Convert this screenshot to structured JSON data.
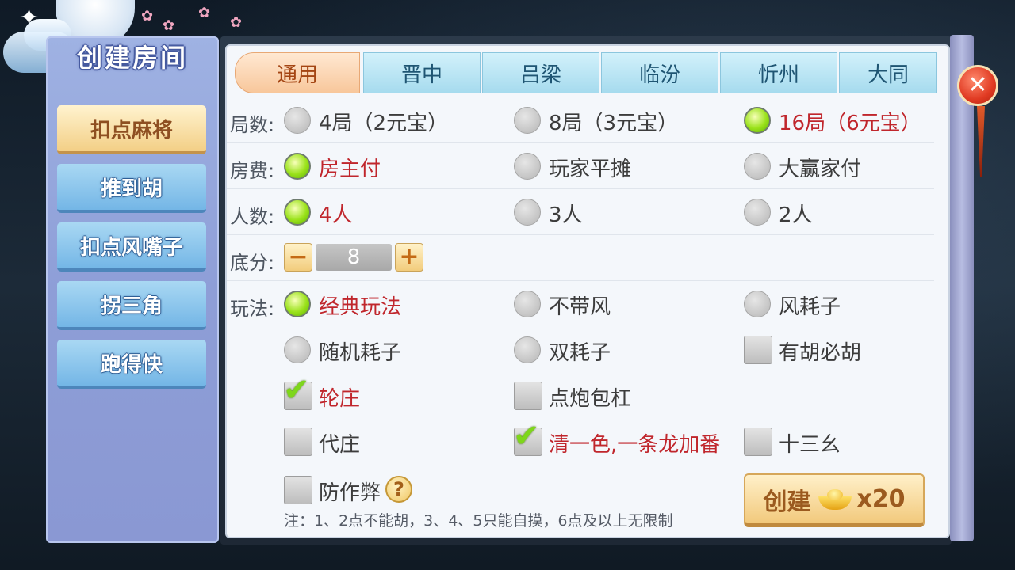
{
  "left_panel": {
    "title": "创建房间",
    "games": [
      {
        "label": "扣点麻将",
        "active": true
      },
      {
        "label": "推到胡",
        "active": false
      },
      {
        "label": "扣点风嘴子",
        "active": false
      },
      {
        "label": "拐三角",
        "active": false
      },
      {
        "label": "跑得快",
        "active": false
      }
    ]
  },
  "tabs": [
    {
      "label": "通用",
      "active": true
    },
    {
      "label": "晋中",
      "active": false
    },
    {
      "label": "吕梁",
      "active": false
    },
    {
      "label": "临汾",
      "active": false
    },
    {
      "label": "忻州",
      "active": false
    },
    {
      "label": "大同",
      "active": false
    }
  ],
  "rounds": {
    "label": "局数:",
    "options": [
      {
        "label": "4局（2元宝）",
        "selected": false
      },
      {
        "label": "8局（3元宝）",
        "selected": false
      },
      {
        "label": "16局（6元宝）",
        "selected": true
      }
    ]
  },
  "fee": {
    "label": "房费:",
    "options": [
      {
        "label": "房主付",
        "selected": true
      },
      {
        "label": "玩家平摊",
        "selected": false
      },
      {
        "label": "大赢家付",
        "selected": false
      }
    ]
  },
  "players": {
    "label": "人数:",
    "options": [
      {
        "label": "4人",
        "selected": true
      },
      {
        "label": "3人",
        "selected": false
      },
      {
        "label": "2人",
        "selected": false
      }
    ]
  },
  "base_score": {
    "label": "底分:",
    "value": "8",
    "minus": "−",
    "plus": "+"
  },
  "play_mode": {
    "label": "玩法:",
    "radios": [
      {
        "label": "经典玩法",
        "selected": true
      },
      {
        "label": "不带风",
        "selected": false
      },
      {
        "label": "风耗子",
        "selected": false
      },
      {
        "label": "随机耗子",
        "selected": false
      },
      {
        "label": "双耗子",
        "selected": false
      }
    ],
    "checks": [
      {
        "label": "有胡必胡",
        "checked": false
      },
      {
        "label": "轮庄",
        "checked": true
      },
      {
        "label": "点炮包杠",
        "checked": false
      },
      {
        "label": "代庄",
        "checked": false
      },
      {
        "label": "清一色,一条龙加番",
        "checked": true
      },
      {
        "label": "十三幺",
        "checked": false
      },
      {
        "label": "防作弊",
        "checked": false
      }
    ]
  },
  "help_icon": "?",
  "note": "注：1、2点不能胡，3、4、5只能自摸，6点及以上无限制",
  "create_button": {
    "label": "创建",
    "cost": "x20"
  },
  "close_icon": "✕",
  "colors": {
    "selected_text": "#c0262c",
    "normal_text": "#3c3c3c",
    "active_tab": "#f8c79b",
    "tab": "#a6dbee"
  }
}
